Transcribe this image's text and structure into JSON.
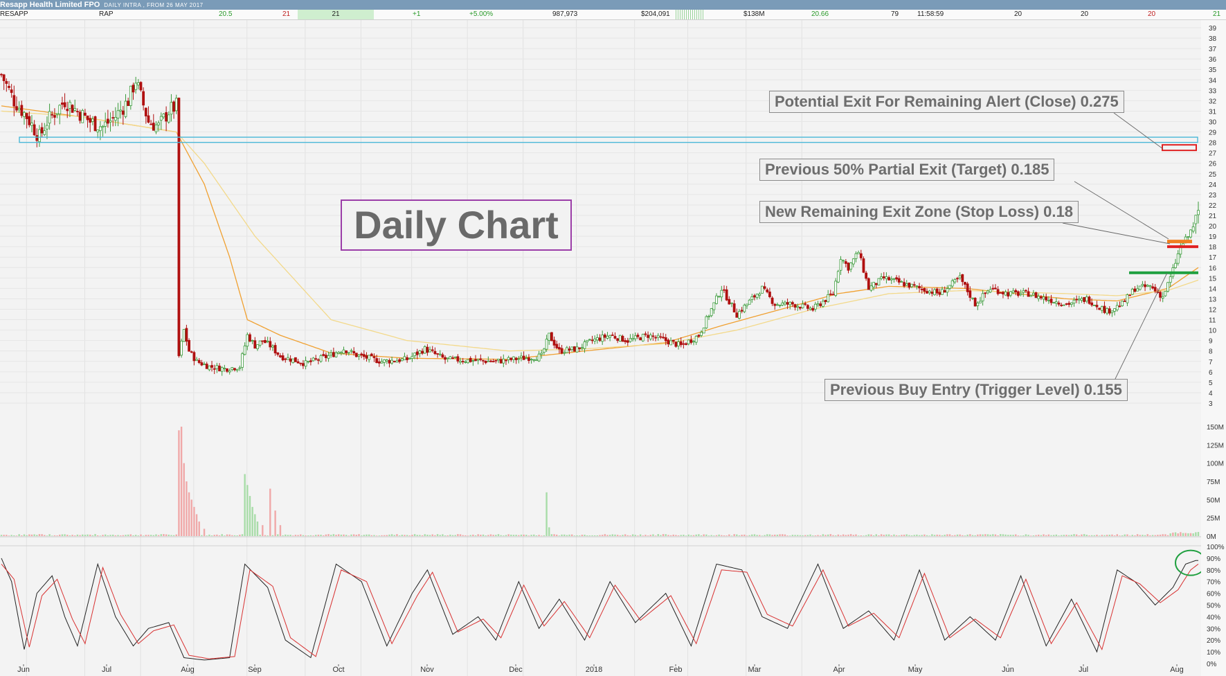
{
  "header": {
    "title": "Resapp Health Limited FPO",
    "subtitle": "DAILY INTRA , FROM 26 MAY 2017"
  },
  "quote_row": {
    "symbol": "RESAPP",
    "code": "RAP",
    "bid": "20.5",
    "ask": "21",
    "last": "21",
    "change": "+1",
    "change_pct": "+5.00%",
    "volume": "987,973",
    "value": "$204,091",
    "mkt_cap": "$138M",
    "vwap": "20.66",
    "trades": "79",
    "time": "11:58:59",
    "open": "20",
    "high": "20",
    "low": "20",
    "close": "21"
  },
  "annotations": {
    "daily_chart": "Daily Chart",
    "potential_exit": "Potential Exit For Remaining Alert (Close) 0.275",
    "partial_exit": "Previous 50% Partial Exit (Target) 0.185",
    "remaining_exit": "New Remaining Exit Zone (Stop Loss) 0.18",
    "buy_entry": "Previous Buy Entry (Trigger Level) 0.155"
  },
  "colors": {
    "up_candle": "#3a9a3a",
    "down_candle": "#b01010",
    "ma_fast": "#f0a030",
    "ma_slow": "#f3d98a",
    "stoch_k": "#222222",
    "stoch_d": "#d83030",
    "resistance_box": "#4ab8d8",
    "exit_close": "#e02020",
    "partial_exit": "#f08020",
    "stop_loss": "#e02020",
    "trigger": "#20a040",
    "circle": "#20a040"
  },
  "chart_data": [
    {
      "type": "candlestick",
      "ylabel": "",
      "ylim": [
        3,
        39
      ],
      "y_ticks": [
        "3",
        "4",
        "5",
        "6",
        "7",
        "8",
        "9",
        "10",
        "11",
        "12",
        "13",
        "14",
        "15",
        "16",
        "17",
        "18",
        "19",
        "20",
        "21",
        "22",
        "23",
        "24",
        "25",
        "26",
        "27",
        "28",
        "29",
        "30",
        "31",
        "32",
        "33",
        "34",
        "35",
        "36",
        "37",
        "38",
        "39"
      ],
      "x_labels": [
        "Jun",
        "Jul",
        "Aug",
        "Sep",
        "Oct",
        "Nov",
        "Dec",
        "2018",
        "Feb",
        "Mar",
        "Apr",
        "May",
        "Jun",
        "Jul",
        "Aug"
      ],
      "close_anchors": [
        [
          0,
          34.5
        ],
        [
          5,
          32
        ],
        [
          10,
          30.5
        ],
        [
          15,
          28.5
        ],
        [
          18,
          30
        ],
        [
          25,
          32
        ],
        [
          30,
          31
        ],
        [
          35,
          30
        ],
        [
          40,
          29.5
        ],
        [
          45,
          30.5
        ],
        [
          50,
          32
        ],
        [
          53,
          34
        ],
        [
          58,
          30
        ],
        [
          62,
          29.5
        ],
        [
          66,
          31
        ],
        [
          69,
          31.5
        ],
        [
          70,
          7.5
        ],
        [
          72,
          10
        ],
        [
          74,
          8
        ],
        [
          77,
          7
        ],
        [
          82,
          6.5
        ],
        [
          88,
          6.3
        ],
        [
          94,
          6.5
        ],
        [
          97,
          9.5
        ],
        [
          100,
          8.5
        ],
        [
          103,
          9
        ],
        [
          106,
          8.5
        ],
        [
          110,
          7.5
        ],
        [
          120,
          6.8
        ],
        [
          130,
          7.6
        ],
        [
          135,
          8.2
        ],
        [
          140,
          7.6
        ],
        [
          150,
          7
        ],
        [
          160,
          7.2
        ],
        [
          167,
          8.2
        ],
        [
          175,
          7.2
        ],
        [
          185,
          7.1
        ],
        [
          195,
          7
        ],
        [
          205,
          7.3
        ],
        [
          213,
          7.5
        ],
        [
          216,
          9.5
        ],
        [
          220,
          8
        ],
        [
          227,
          8.2
        ],
        [
          233,
          9
        ],
        [
          240,
          9.5
        ],
        [
          247,
          9
        ],
        [
          255,
          9.5
        ],
        [
          262,
          9
        ],
        [
          268,
          8.5
        ],
        [
          275,
          9.5
        ],
        [
          280,
          12
        ],
        [
          284,
          14
        ],
        [
          290,
          11.5
        ],
        [
          296,
          13
        ],
        [
          300,
          14
        ],
        [
          305,
          12.5
        ],
        [
          312,
          12.5
        ],
        [
          320,
          12
        ],
        [
          328,
          13.5
        ],
        [
          331,
          17
        ],
        [
          334,
          16
        ],
        [
          338,
          17.5
        ],
        [
          342,
          14
        ],
        [
          348,
          15
        ],
        [
          355,
          14.5
        ],
        [
          362,
          14
        ],
        [
          370,
          13.5
        ],
        [
          378,
          15
        ],
        [
          384,
          12.5
        ],
        [
          390,
          14
        ],
        [
          397,
          13.5
        ],
        [
          405,
          13.5
        ],
        [
          412,
          13
        ],
        [
          420,
          12.5
        ],
        [
          428,
          13
        ],
        [
          436,
          11.8
        ],
        [
          442,
          12.5
        ],
        [
          447,
          14
        ],
        [
          453,
          14.2
        ],
        [
          458,
          13.2
        ],
        [
          461,
          15
        ],
        [
          465,
          18
        ],
        [
          468,
          19
        ],
        [
          470,
          20
        ],
        [
          472,
          21
        ]
      ],
      "moving_averages": [
        {
          "name": "",
          "color": "#f0a030",
          "points": [
            [
              0,
              31.5
            ],
            [
              30,
              30.5
            ],
            [
              69,
              29
            ],
            [
              80,
              24
            ],
            [
              90,
              17
            ],
            [
              97,
              11
            ],
            [
              110,
              9.5
            ],
            [
              130,
              7.8
            ],
            [
              160,
              7.3
            ],
            [
              200,
              7.2
            ],
            [
              230,
              8
            ],
            [
              262,
              8.8
            ],
            [
              285,
              10.5
            ],
            [
              300,
              11.5
            ],
            [
              330,
              13.5
            ],
            [
              350,
              14.2
            ],
            [
              380,
              14
            ],
            [
              420,
              13
            ],
            [
              440,
              12.8
            ],
            [
              460,
              14
            ],
            [
              472,
              16
            ]
          ]
        },
        {
          "name": "",
          "color": "#f3d98a",
          "points": [
            [
              0,
              31
            ],
            [
              30,
              30.5
            ],
            [
              69,
              29
            ],
            [
              80,
              26
            ],
            [
              100,
              19
            ],
            [
              130,
              11
            ],
            [
              160,
              9
            ],
            [
              200,
              8
            ],
            [
              230,
              8.2
            ],
            [
              262,
              8.7
            ],
            [
              290,
              10
            ],
            [
              320,
              12
            ],
            [
              350,
              13.5
            ],
            [
              380,
              13.8
            ],
            [
              420,
              13.5
            ],
            [
              440,
              13.3
            ],
            [
              460,
              13.8
            ],
            [
              472,
              14.8
            ]
          ]
        }
      ],
      "levels": [
        {
          "label": "Potential Exit For Remaining Alert (Close) 0.275",
          "value": 27.5,
          "color": "#e02020"
        },
        {
          "label": "Previous 50% Partial Exit (Target) 0.185",
          "value": 18.5,
          "color": "#f08020"
        },
        {
          "label": "New Remaining Exit Zone (Stop Loss) 0.18",
          "value": 18,
          "color": "#e02020"
        },
        {
          "label": "Previous Buy Entry (Trigger Level) 0.155",
          "value": 15.5,
          "color": "#20a040"
        }
      ],
      "resistance_zone": [
        28,
        28.5
      ]
    },
    {
      "type": "bar",
      "ylabel": "",
      "ylim": [
        0,
        150
      ],
      "y_ticks": [
        "0M",
        "25M",
        "50M",
        "75M",
        "100M",
        "125M",
        "150M"
      ],
      "spikes": [
        [
          70,
          145,
          "down"
        ],
        [
          71,
          150,
          "down"
        ],
        [
          72,
          100,
          "down"
        ],
        [
          73,
          75,
          "down"
        ],
        [
          74,
          60,
          "down"
        ],
        [
          75,
          50,
          "down"
        ],
        [
          76,
          40,
          "down"
        ],
        [
          77,
          30,
          "down"
        ],
        [
          78,
          20,
          "down"
        ],
        [
          80,
          10,
          "down"
        ],
        [
          96,
          85,
          "up"
        ],
        [
          97,
          70,
          "up"
        ],
        [
          98,
          55,
          "up"
        ],
        [
          99,
          40,
          "up"
        ],
        [
          100,
          30,
          "up"
        ],
        [
          101,
          20,
          "up"
        ],
        [
          103,
          15,
          "down"
        ],
        [
          106,
          65,
          "down"
        ],
        [
          108,
          35,
          "down"
        ],
        [
          110,
          15,
          "down"
        ],
        [
          215,
          60,
          "up"
        ],
        [
          216,
          12,
          "up"
        ]
      ]
    },
    {
      "type": "line",
      "ylabel": "",
      "ylim": [
        0,
        100
      ],
      "y_ticks": [
        "0%",
        "10%",
        "20%",
        "30%",
        "40%",
        "50%",
        "60%",
        "70%",
        "80%",
        "90%",
        "100%"
      ],
      "series": [
        {
          "name": "",
          "color": "#222222",
          "anchors": [
            [
              0,
              90
            ],
            [
              4,
              70
            ],
            [
              9,
              12
            ],
            [
              14,
              60
            ],
            [
              20,
              75
            ],
            [
              25,
              40
            ],
            [
              30,
              15
            ],
            [
              38,
              85
            ],
            [
              45,
              40
            ],
            [
              52,
              15
            ],
            [
              58,
              30
            ],
            [
              66,
              35
            ],
            [
              72,
              5
            ],
            [
              80,
              3
            ],
            [
              90,
              5
            ],
            [
              96,
              85
            ],
            [
              105,
              65
            ],
            [
              112,
              20
            ],
            [
              122,
              5
            ],
            [
              132,
              85
            ],
            [
              142,
              70
            ],
            [
              152,
              15
            ],
            [
              162,
              60
            ],
            [
              168,
              80
            ],
            [
              178,
              25
            ],
            [
              188,
              40
            ],
            [
              195,
              20
            ],
            [
              204,
              70
            ],
            [
              212,
              30
            ],
            [
              220,
              55
            ],
            [
              230,
              20
            ],
            [
              240,
              70
            ],
            [
              250,
              35
            ],
            [
              262,
              60
            ],
            [
              272,
              15
            ],
            [
              282,
              85
            ],
            [
              292,
              80
            ],
            [
              300,
              40
            ],
            [
              310,
              30
            ],
            [
              322,
              85
            ],
            [
              332,
              30
            ],
            [
              342,
              45
            ],
            [
              352,
              20
            ],
            [
              362,
              80
            ],
            [
              372,
              20
            ],
            [
              382,
              40
            ],
            [
              392,
              20
            ],
            [
              402,
              75
            ],
            [
              412,
              15
            ],
            [
              422,
              55
            ],
            [
              432,
              10
            ],
            [
              440,
              80
            ],
            [
              447,
              70
            ],
            [
              455,
              50
            ],
            [
              462,
              65
            ],
            [
              467,
              85
            ],
            [
              471,
              88
            ]
          ]
        },
        {
          "name": "",
          "color": "#d83030",
          "anchors": [
            [
              0,
              85
            ],
            [
              5,
              72
            ],
            [
              11,
              14
            ],
            [
              16,
              58
            ],
            [
              22,
              72
            ],
            [
              28,
              38
            ],
            [
              33,
              17
            ],
            [
              40,
              82
            ],
            [
              47,
              42
            ],
            [
              54,
              17
            ],
            [
              60,
              28
            ],
            [
              68,
              33
            ],
            [
              74,
              7
            ],
            [
              82,
              4
            ],
            [
              92,
              6
            ],
            [
              98,
              80
            ],
            [
              107,
              66
            ],
            [
              114,
              22
            ],
            [
              124,
              6
            ],
            [
              134,
              80
            ],
            [
              144,
              70
            ],
            [
              154,
              17
            ],
            [
              164,
              58
            ],
            [
              170,
              78
            ],
            [
              180,
              27
            ],
            [
              190,
              38
            ],
            [
              197,
              22
            ],
            [
              206,
              67
            ],
            [
              214,
              32
            ],
            [
              222,
              53
            ],
            [
              232,
              22
            ],
            [
              242,
              67
            ],
            [
              252,
              37
            ],
            [
              264,
              58
            ],
            [
              274,
              17
            ],
            [
              284,
              80
            ],
            [
              294,
              78
            ],
            [
              302,
              42
            ],
            [
              312,
              32
            ],
            [
              324,
              80
            ],
            [
              334,
              32
            ],
            [
              344,
              43
            ],
            [
              354,
              22
            ],
            [
              364,
              77
            ],
            [
              374,
              22
            ],
            [
              384,
              38
            ],
            [
              394,
              22
            ],
            [
              404,
              72
            ],
            [
              414,
              17
            ],
            [
              424,
              52
            ],
            [
              434,
              12
            ],
            [
              442,
              75
            ],
            [
              449,
              68
            ],
            [
              457,
              52
            ],
            [
              464,
              63
            ],
            [
              469,
              80
            ],
            [
              472,
              85
            ]
          ]
        }
      ]
    }
  ]
}
